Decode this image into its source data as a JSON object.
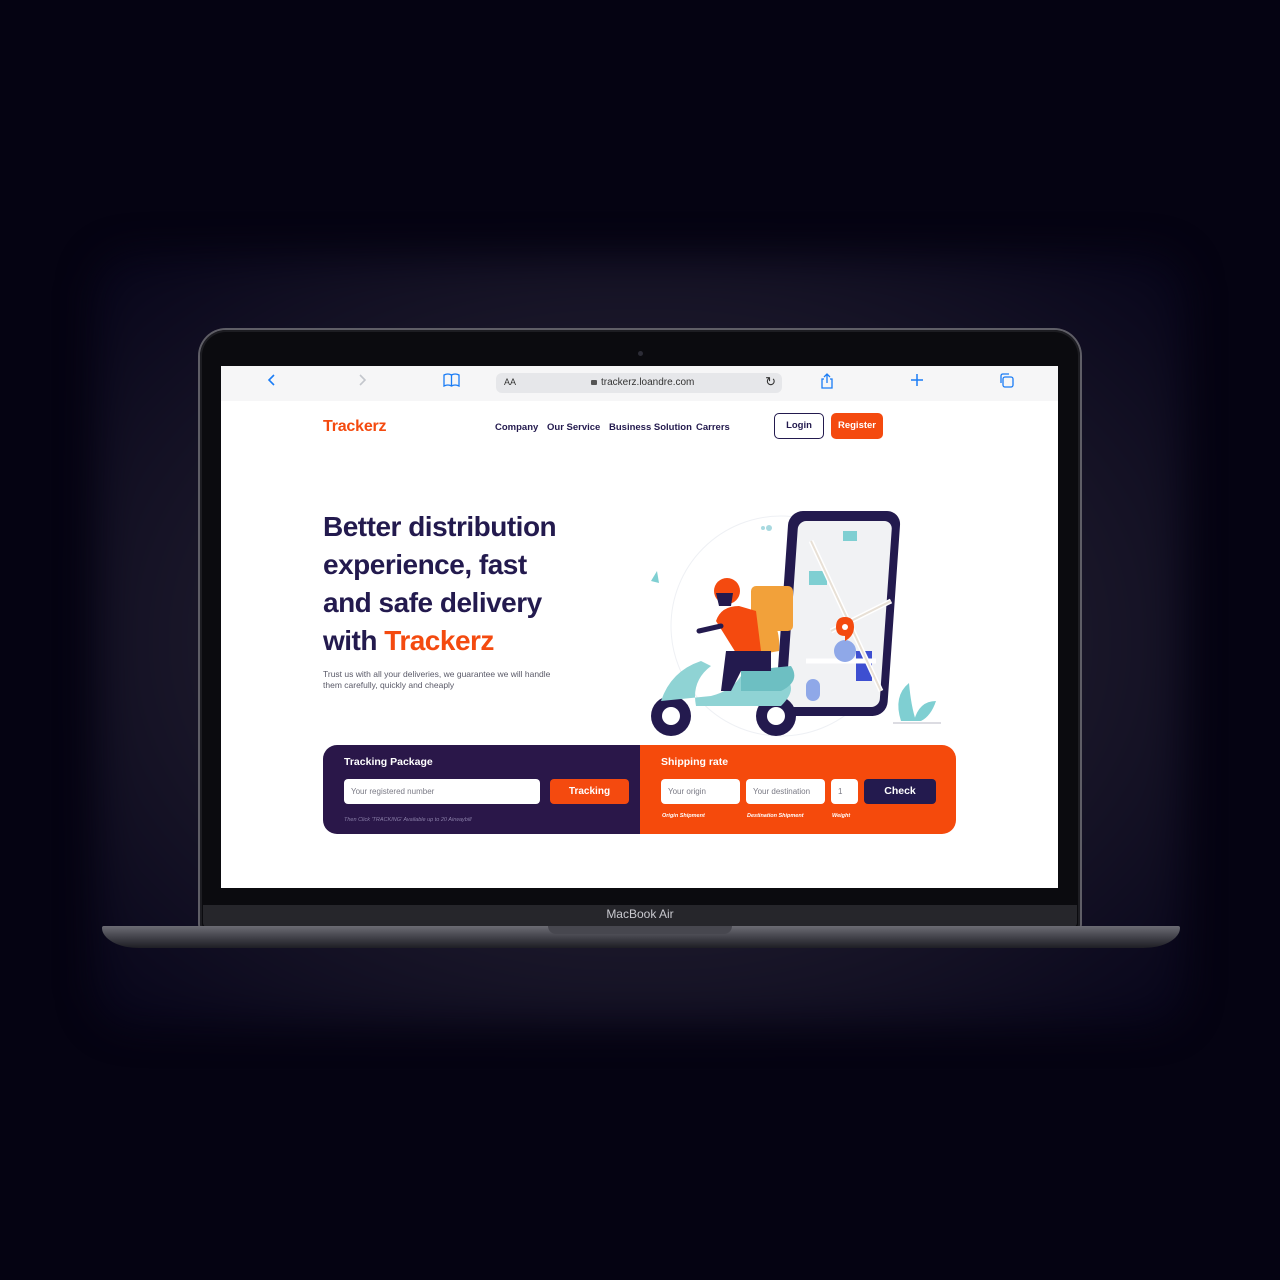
{
  "device": {
    "label": "MacBook Air"
  },
  "browser": {
    "text_size_label": "AA",
    "url": "trackerz.loandre.com",
    "icons": [
      "back-icon",
      "forward-icon",
      "bookmarks-icon",
      "lock-icon",
      "reload-icon",
      "share-icon",
      "new-tab-icon",
      "tabs-icon"
    ]
  },
  "header": {
    "logo": "Trackerz",
    "nav": [
      "Company",
      "Our Service",
      "Business Solution",
      "Carrers"
    ],
    "login_label": "Login",
    "register_label": "Register"
  },
  "hero": {
    "title_lines": [
      "Better distribution",
      "experience, fast",
      "and safe delivery"
    ],
    "title_prefix": "with ",
    "title_brand": "Trackerz",
    "subtitle_line1": "Trust us with all your deliveries, we guarantee we will handle",
    "subtitle_line2": "them carefully, quickly and cheaply"
  },
  "tracking": {
    "title": "Tracking Package",
    "placeholder": "Your registered number",
    "button_label": "Tracking",
    "hint": "Then Click 'TRACKING' Available up to 20 Airwaybill"
  },
  "shipping": {
    "title": "Shipping rate",
    "origin_placeholder": "Your origin",
    "destination_placeholder": "Your destination",
    "weight_value": "1",
    "origin_label": "Origin Shipment",
    "destination_label": "Destination Shipment",
    "weight_label": "Weight",
    "button_label": "Check"
  },
  "colors": {
    "brand_orange": "#f44a0f",
    "navy": "#231a4e",
    "tracking_bg": "#2a1749",
    "safari_blue": "#1a7cf5"
  }
}
